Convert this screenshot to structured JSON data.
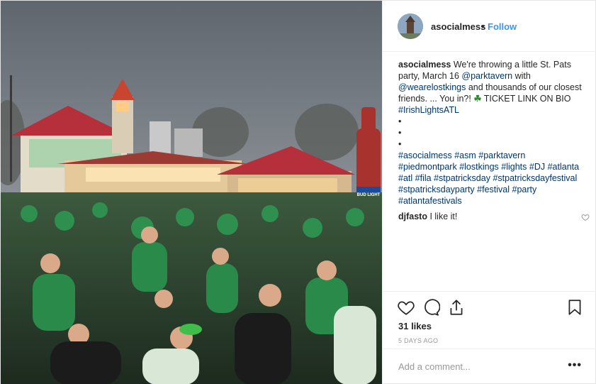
{
  "post": {
    "username": "asocialmess",
    "follow_label": "Follow",
    "separator": "•",
    "caption_user": "asocialmess",
    "caption_text_1": " We're throwing a little St. Pats party, March 16 ",
    "mention_1": "@parktavern",
    "caption_text_2": " with ",
    "mention_2": "@wearelostkings",
    "caption_text_3": " and thousands of our closest friends. ... You in?! ",
    "clover": "☘",
    "caption_text_4": " TICKET LINK ON BIO",
    "hashtag_top": "#IrishLightsATL",
    "bullets": [
      "•",
      "•",
      "•"
    ],
    "hashtags": [
      "#asocialmess",
      "#asm",
      "#parktavern",
      "#piedmontpark",
      "#lostkings",
      "#lights",
      "#DJ",
      "#atlanta",
      "#atl",
      "#fila",
      "#stpatricksday",
      "#stpatricksdayfestival",
      "#stpatricksdayparty",
      "#festival",
      "#party",
      "#atlantafestivals"
    ],
    "comments": [
      {
        "user": "djfasto",
        "text": " I like it!"
      }
    ],
    "likes": "31 likes",
    "timestamp": "5 DAYS AGO",
    "add_comment_placeholder": "Add a comment...",
    "more_label": "•••"
  },
  "photo": {
    "bottle_label": "BUD LIGHT",
    "icons": {
      "like": "heart-icon",
      "comment": "comment-icon",
      "share": "share-icon",
      "save": "bookmark-icon"
    }
  },
  "colors": {
    "link": "#3897f0",
    "tag": "#003569",
    "roof": "#b5303a",
    "crowd_green": "#2f8f4e"
  }
}
